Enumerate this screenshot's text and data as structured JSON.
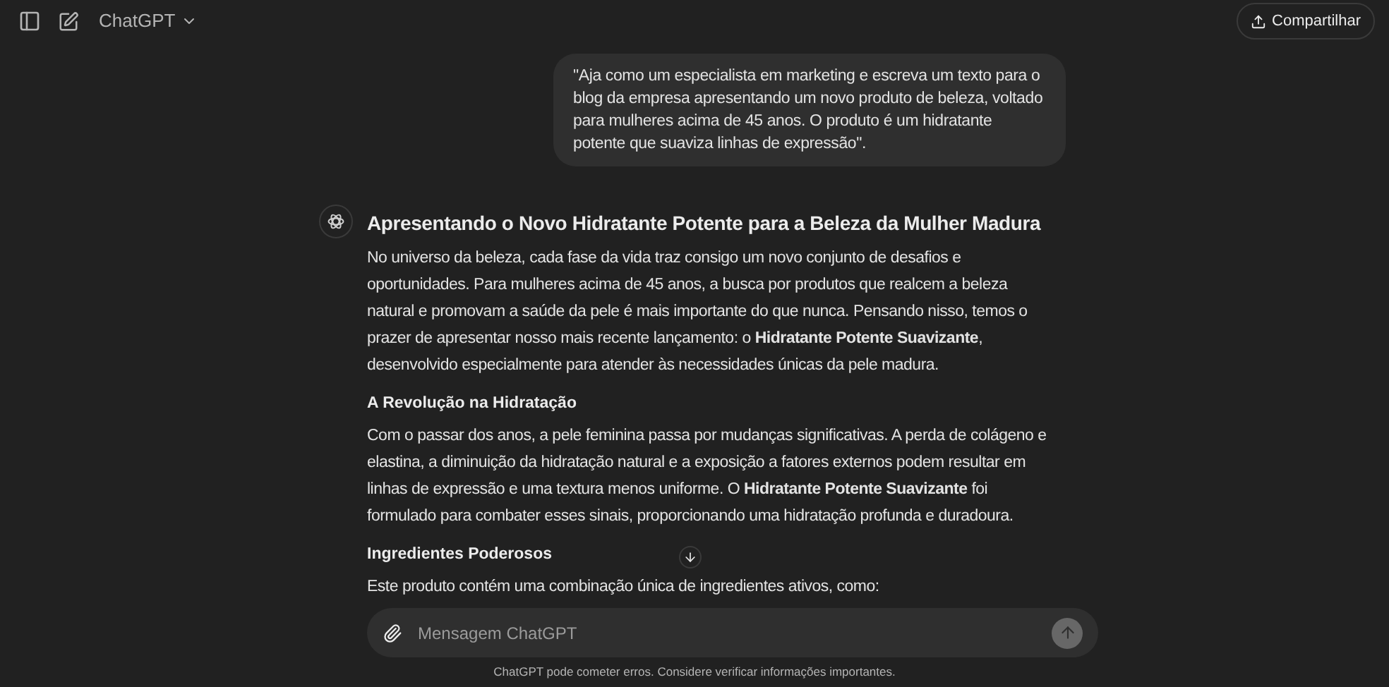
{
  "header": {
    "model": "ChatGPT",
    "share": "Compartilhar"
  },
  "user_message": "\"Aja como um especialista em marketing e escreva um texto para o blog da empresa apresentando um novo produto de beleza, voltado para mulheres acima de 45 anos. O produto é um hidratante potente que suaviza linhas de expressão\".",
  "response": [
    {
      "kind": "title",
      "text": "Apresentando o Novo Hidratante Potente para a Beleza da Mulher Madura"
    },
    {
      "kind": "paragraph",
      "text": "No universo da beleza, cada fase da vida traz consigo um novo conjunto de desafios e oportunidades. Para mulheres acima de 45 anos, a busca por produtos que realcem a beleza natural e promovam a saúde da pele é mais importante do que nunca. Pensando nisso, temos o prazer de apresentar nosso mais recente lançamento: o **Hidratante Potente Suavizante**, desenvolvido especialmente para atender às necessidades únicas da pele madura."
    },
    {
      "kind": "subheading",
      "text": "A Revolução na Hidratação"
    },
    {
      "kind": "paragraph",
      "text": "Com o passar dos anos, a pele feminina passa por mudanças significativas. A perda de colágeno e elastina, a diminuição da hidratação natural e a exposição a fatores externos podem resultar em linhas de expressão e uma textura menos uniforme. O **Hidratante Potente Suavizante** foi formulado para combater esses sinais, proporcionando uma hidratação profunda e duradoura."
    },
    {
      "kind": "subheading",
      "text": "Ingredientes Poderosos"
    },
    {
      "kind": "paragraph",
      "text": "Este produto contém uma combinação única de ingredientes ativos, como:"
    }
  ],
  "composer": {
    "placeholder": "Mensagem ChatGPT"
  },
  "disclaimer": "ChatGPT pode cometer erros. Considere verificar informações importantes."
}
